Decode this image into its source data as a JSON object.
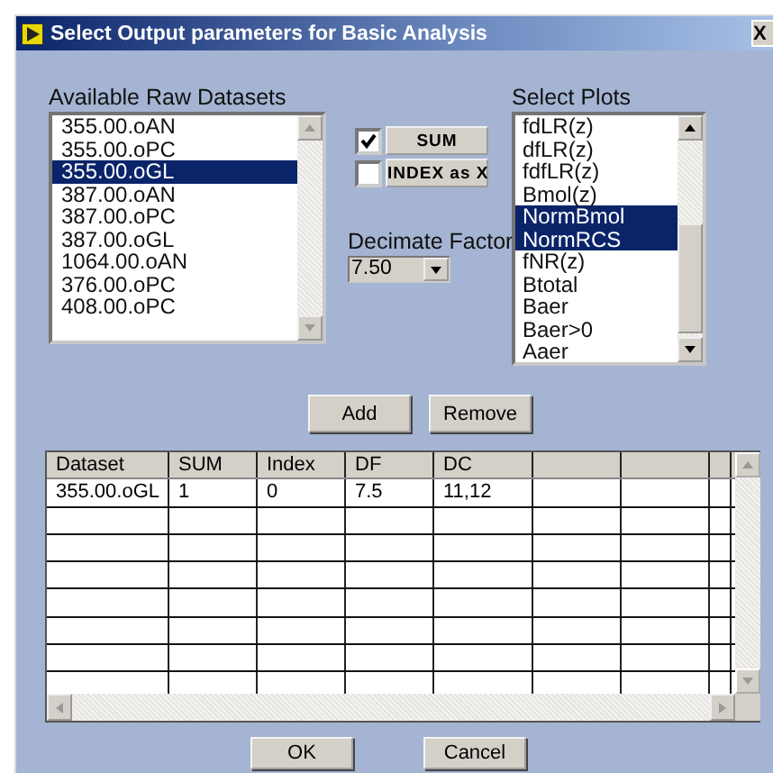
{
  "window": {
    "title": "Select Output parameters for Basic Analysis",
    "close": "X"
  },
  "datasets": {
    "label": "Available Raw Datasets",
    "items": [
      {
        "text": "355.00.oAN",
        "selected": false
      },
      {
        "text": "355.00.oPC",
        "selected": false
      },
      {
        "text": "355.00.oGL",
        "selected": true
      },
      {
        "text": "387.00.oAN",
        "selected": false
      },
      {
        "text": "387.00.oPC",
        "selected": false
      },
      {
        "text": "387.00.oGL",
        "selected": false
      },
      {
        "text": "1064.00.oAN",
        "selected": false
      },
      {
        "text": "376.00.oPC",
        "selected": false
      },
      {
        "text": "408.00.oPC",
        "selected": false
      }
    ]
  },
  "options": [
    {
      "label": "SUM",
      "checked": true
    },
    {
      "label": "INDEX as X",
      "checked": false
    }
  ],
  "decimate": {
    "label": "Decimate Factor",
    "value": "7.50"
  },
  "plots": {
    "label": "Select Plots",
    "items": [
      {
        "text": "fdLR(z)",
        "selected": false
      },
      {
        "text": "dfLR(z)",
        "selected": false
      },
      {
        "text": "fdfLR(z)",
        "selected": false
      },
      {
        "text": "Bmol(z)",
        "selected": false
      },
      {
        "text": "NormBmol",
        "selected": true
      },
      {
        "text": "NormRCS",
        "selected": true
      },
      {
        "text": "fNR(z)",
        "selected": false
      },
      {
        "text": "Btotal",
        "selected": false
      },
      {
        "text": "Baer",
        "selected": false
      },
      {
        "text": "Baer>0",
        "selected": false
      },
      {
        "text": "Aaer",
        "selected": false
      }
    ]
  },
  "actions": [
    "Add",
    "Remove"
  ],
  "table": {
    "columns": [
      {
        "label": "Dataset"
      },
      {
        "label": "SUM"
      },
      {
        "label": "Index"
      },
      {
        "label": "DF"
      },
      {
        "label": "DC"
      },
      {},
      {},
      {}
    ],
    "rows": [
      [
        "355.00.oGL",
        "1",
        "0",
        "7.5",
        "11,12"
      ]
    ]
  },
  "buttons": [
    "OK",
    "Cancel"
  ]
}
